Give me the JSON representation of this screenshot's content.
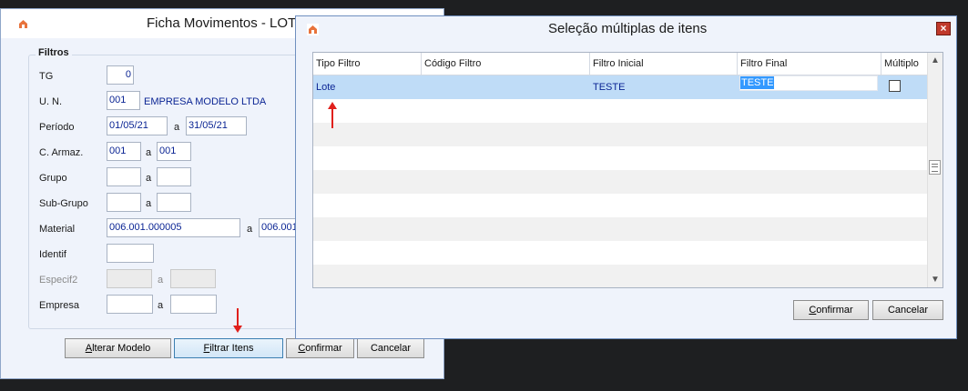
{
  "back_window": {
    "title": "Ficha Movimentos - LOTE",
    "groupbox": "Filtros",
    "fields": {
      "tg": {
        "label": "TG",
        "value": "0"
      },
      "un": {
        "label": "U. N.",
        "code": "001",
        "name": "EMPRESA MODELO LTDA"
      },
      "periodo": {
        "label": "Período",
        "from": "01/05/21",
        "sep": "a",
        "to": "31/05/21"
      },
      "carmaz": {
        "label": "C. Armaz.",
        "from": "001",
        "sep": "a",
        "to": "001"
      },
      "grupo": {
        "label": "Grupo",
        "from": "",
        "sep": "a",
        "to": ""
      },
      "subgrupo": {
        "label": "Sub-Grupo",
        "from": "",
        "sep": "a",
        "to": ""
      },
      "material": {
        "label": "Material",
        "from": "006.001.000005",
        "sep": "a",
        "to": "006.001"
      },
      "identif": {
        "label": "Identif",
        "value": ""
      },
      "especif2": {
        "label": "Especif2",
        "from": "",
        "sep": "a",
        "to": ""
      },
      "empresa": {
        "label": "Empresa",
        "from": "",
        "sep": "a",
        "to": ""
      }
    },
    "buttons": {
      "alterar_modelo": {
        "underlined": "A",
        "rest": "lterar Modelo"
      },
      "filtrar_itens": {
        "underlined": "F",
        "rest": "iltrar Itens"
      },
      "confirmar": {
        "underlined": "C",
        "rest": "onfirmar"
      },
      "cancelar": {
        "underlined": "",
        "rest": "Cancelar"
      }
    }
  },
  "dialog": {
    "title": "Seleção múltiplas de itens",
    "close": "×",
    "columns": [
      "Tipo Filtro",
      "Código Filtro",
      "Filtro Inicial",
      "Filtro Final",
      "Múltiplo"
    ],
    "row": {
      "tipo": "Lote",
      "codigo": "",
      "inicial": "TESTE",
      "final": "TESTE"
    },
    "scroll_up": "▲",
    "scroll_down": "▼",
    "buttons": {
      "confirmar": {
        "underlined": "C",
        "rest": "onfirmar"
      },
      "cancelar": {
        "underlined": "",
        "rest": "Cancelar"
      }
    }
  },
  "colors": {
    "background": "#1e1f21",
    "window": "#eff3fb",
    "field_text": "#0b2594",
    "selection": "#3399ff",
    "row_selected": "#bfdcf7",
    "close_button": "#c0392b",
    "annotation_arrow": "#e0201c"
  },
  "icons": {
    "app": "app-logo-icon",
    "close": "close-icon",
    "checkbox": "checkbox-unchecked-icon"
  }
}
